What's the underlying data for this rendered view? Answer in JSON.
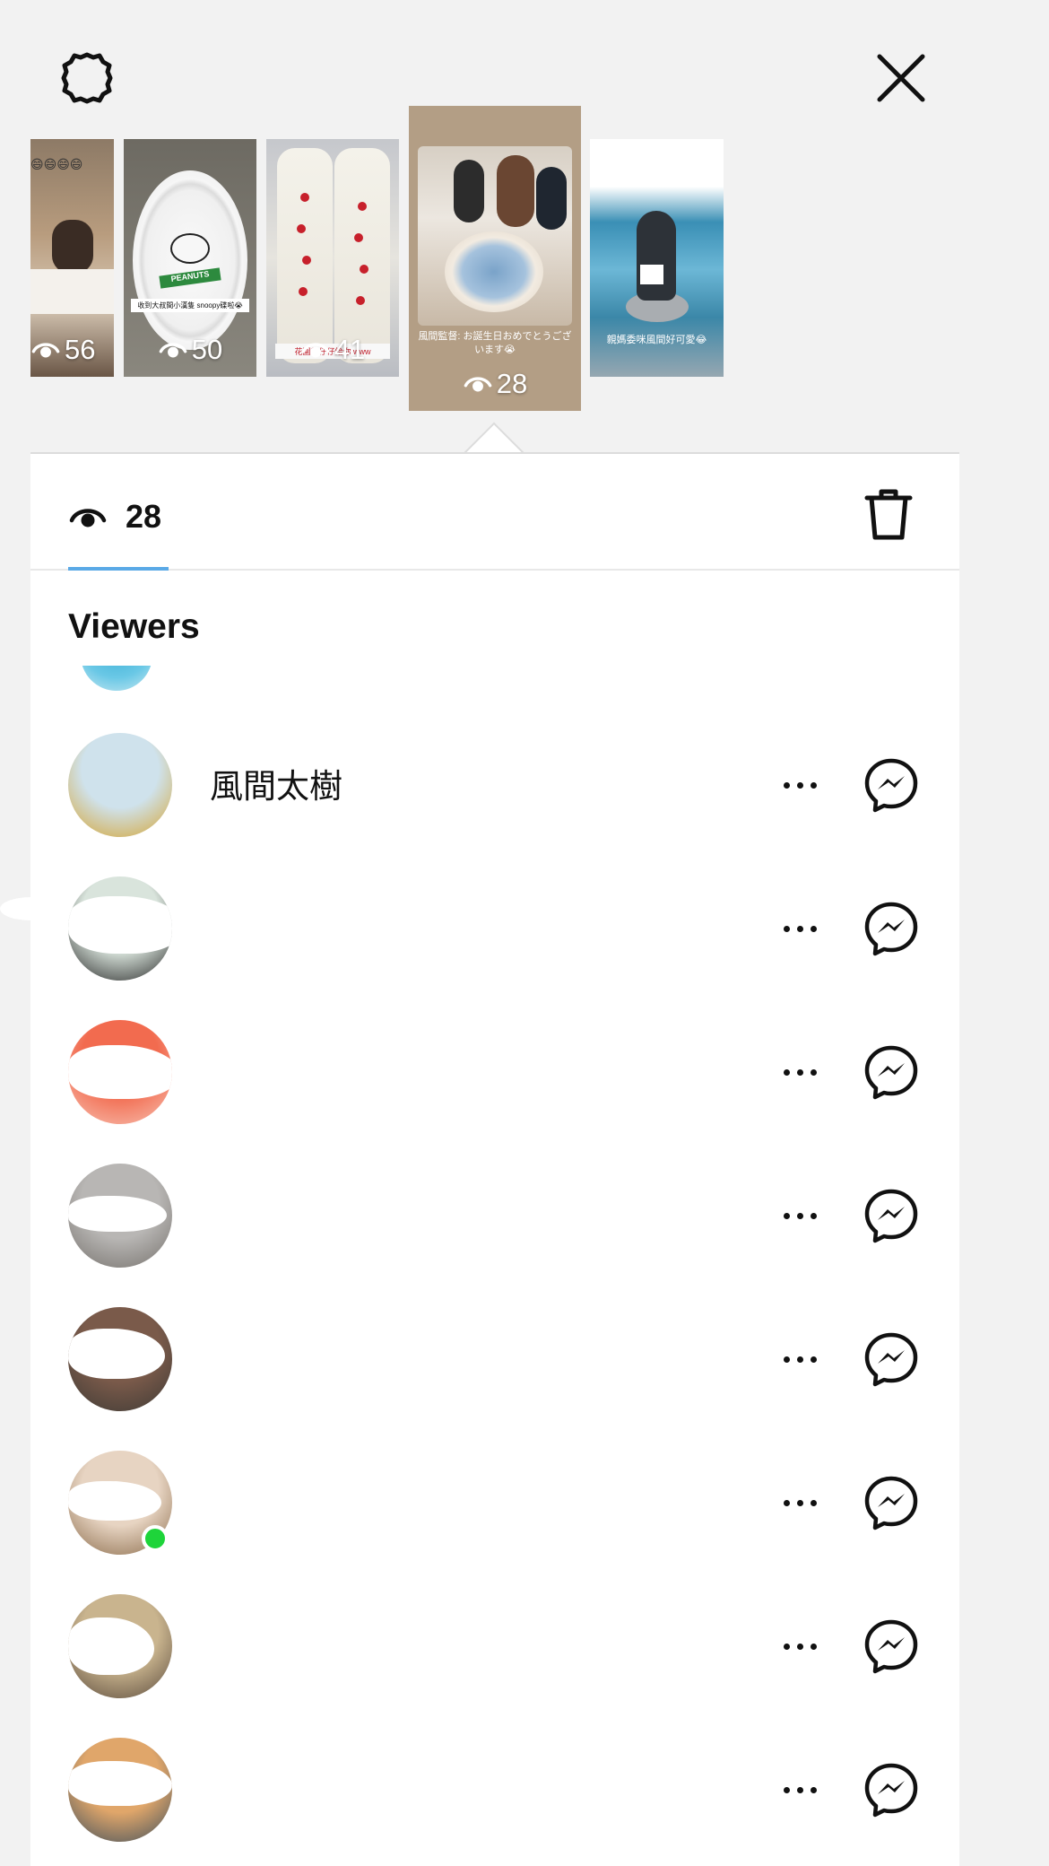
{
  "topbar": {
    "settings_icon": "gear-icon",
    "close_icon": "close-icon"
  },
  "story_strip": {
    "thumbnails": [
      {
        "views": "56",
        "emoji": "😄😄😄😄"
      },
      {
        "views": "50",
        "caption": "收到大叔間小漢隻 snoopy碟啦😭",
        "label": "PEANUTS"
      },
      {
        "views": "41",
        "caption": "花園般仔仔給你 www"
      },
      {
        "views": "28",
        "caption": "風間監督:\nお誕生日おめでとうございます😭",
        "selected": true
      },
      {
        "views": "",
        "caption": "親媽委咪風間好可愛😂"
      }
    ]
  },
  "panel": {
    "views_tab": {
      "count": "28",
      "icon": "eye-icon"
    },
    "delete_icon": "trash-icon",
    "section_title": "Viewers",
    "viewers": [
      {
        "name": "風間太樹",
        "avatar_colors": [
          "#cfe2ec",
          "#d5a32e"
        ],
        "online": false
      },
      {
        "name": "",
        "avatar_colors": [
          "#d9e4dc",
          "#222222"
        ],
        "online": false
      },
      {
        "name": "",
        "avatar_colors": [
          "#f26b4f",
          "#f7c3b4"
        ],
        "online": false
      },
      {
        "name": "",
        "avatar_colors": [
          "#b8b6b4",
          "#75716c"
        ],
        "online": false
      },
      {
        "name": "",
        "avatar_colors": [
          "#7a5a4a",
          "#3d3a35"
        ],
        "online": false
      },
      {
        "name": "",
        "avatar_colors": [
          "#e7d4c2",
          "#8a6b4a"
        ],
        "online": true
      },
      {
        "name": "",
        "avatar_colors": [
          "#c9b48e",
          "#5a4a3c"
        ],
        "online": false
      },
      {
        "name": "",
        "avatar_colors": [
          "#e0a66a",
          "#3e4f5c"
        ],
        "online": false
      }
    ],
    "row_more_icon": "more-dots-icon",
    "row_message_icon": "messenger-icon"
  }
}
